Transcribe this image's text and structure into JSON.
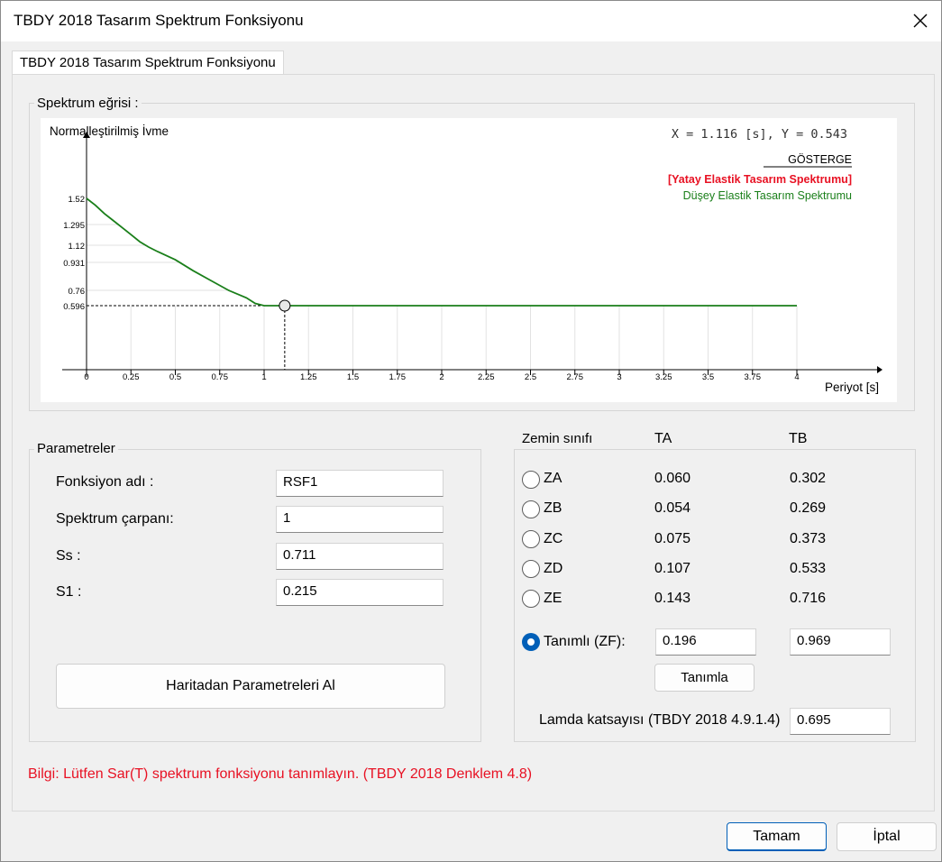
{
  "window": {
    "title": "TBDY 2018 Tasarım Spektrum Fonksiyonu",
    "close_icon": "close-icon"
  },
  "tabs": [
    {
      "label": "TBDY 2018 Tasarım Spektrum Fonksiyonu",
      "active": true
    }
  ],
  "spectrum_group": {
    "label": "Spektrum eğrisi :"
  },
  "chart_data": {
    "type": "line",
    "ylabel": "Normalleştirilmiş İvme",
    "xlabel": "Periyot [s]",
    "readout": "X = 1.116 [s],  Y = 0.543",
    "legend_title": "GÖSTERGE",
    "legend": [
      {
        "name": "[Yatay Elastik Tasarım Spektrumu]",
        "color": "#e81123"
      },
      {
        "name": "Düşey Elastik Tasarım Spektrumu",
        "color": "#1a7f1a"
      }
    ],
    "x_ticks": [
      "0",
      "0.25",
      "0.5",
      "0.75",
      "1",
      "1.25",
      "1.5",
      "1.75",
      "2",
      "2.25",
      "2.5",
      "2.75",
      "3",
      "3.25",
      "3.5",
      "3.75",
      "4"
    ],
    "y_ticks": [
      "0.596",
      "0.76",
      "0.931",
      "1.12",
      "1.295",
      "1.52"
    ],
    "xlim": [
      0,
      4
    ],
    "cursor": {
      "x": 1.116,
      "y": 0.596
    },
    "series": [
      {
        "name": "Düşey Elastik Tasarım Spektrumu",
        "color": "#1a7f1a",
        "x": [
          0,
          0.05,
          0.1,
          0.15,
          0.2,
          0.25,
          0.3,
          0.35,
          0.4,
          0.5,
          0.6,
          0.7,
          0.8,
          0.9,
          0.95,
          1.0,
          1.5,
          2.0,
          2.5,
          3.0,
          3.5,
          4.0
        ],
        "y": [
          1.52,
          1.46,
          1.39,
          1.33,
          1.27,
          1.21,
          1.15,
          1.1,
          1.05,
          0.96,
          0.88,
          0.82,
          0.76,
          0.68,
          0.62,
          0.596,
          0.596,
          0.596,
          0.596,
          0.596,
          0.596,
          0.596
        ]
      }
    ]
  },
  "params_group": {
    "label": "Parametreler",
    "function_name_label": "Fonksiyon adı :",
    "function_name_value": "RSF1",
    "scale_label": "Spektrum çarpanı:",
    "scale_value": "1",
    "ss_label": "Ss :",
    "ss_value": "0.711",
    "s1_label": "S1 :",
    "s1_value": "0.215",
    "map_button": "Haritadan Parametreleri Al"
  },
  "soil": {
    "header_class": "Zemin sınıfı",
    "header_ta": "TA",
    "header_tb": "TB",
    "rows": [
      {
        "label": "ZA",
        "ta": "0.060",
        "tb": "0.302",
        "checked": false
      },
      {
        "label": "ZB",
        "ta": "0.054",
        "tb": "0.269",
        "checked": false
      },
      {
        "label": "ZC",
        "ta": "0.075",
        "tb": "0.373",
        "checked": false
      },
      {
        "label": "ZD",
        "ta": "0.107",
        "tb": "0.533",
        "checked": false
      },
      {
        "label": "ZE",
        "ta": "0.143",
        "tb": "0.716",
        "checked": false
      }
    ],
    "custom_label": "Tanımlı (ZF):",
    "custom_checked": true,
    "custom_ta": "0.196",
    "custom_tb": "0.969",
    "define_button": "Tanımla",
    "lambda_label": "Lamda katsayısı (TBDY 2018 4.9.1.4)",
    "lambda_value": "0.695"
  },
  "info_text": "Bilgi: Lütfen Sar(T) spektrum fonksiyonu tanımlayın. (TBDY 2018 Denklem 4.8)",
  "footer": {
    "ok": "Tamam",
    "cancel": "İptal"
  }
}
